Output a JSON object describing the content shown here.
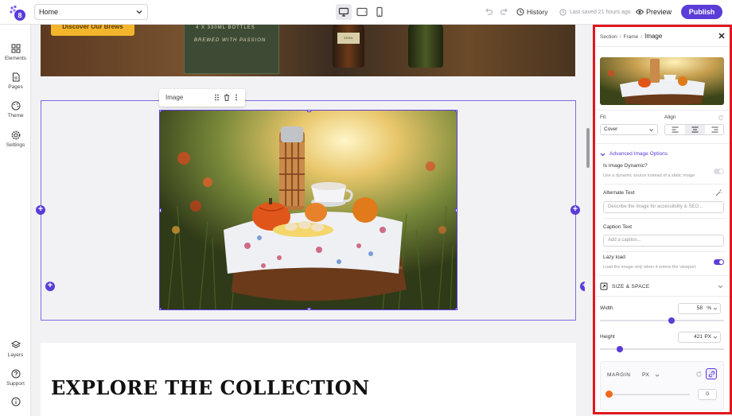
{
  "topbar": {
    "page_name": "Home",
    "history_label": "History",
    "last_saved": "Last saved 21 hours ago",
    "preview_label": "Preview",
    "publish_label": "Publish",
    "device_icons": [
      "desktop-icon",
      "tablet-icon",
      "mobile-icon"
    ],
    "active_device": "desktop"
  },
  "sidebar": {
    "items": [
      {
        "label": "Elements",
        "icon": "grid-icon"
      },
      {
        "label": "Pages",
        "icon": "page-icon"
      },
      {
        "label": "Theme",
        "icon": "palette-icon"
      },
      {
        "label": "Settings",
        "icon": "gear-icon"
      }
    ],
    "bottom_items": [
      {
        "label": "Layers",
        "icon": "layers-icon"
      },
      {
        "label": "Support",
        "icon": "help-icon"
      },
      {
        "label": "",
        "icon": "info-icon"
      }
    ]
  },
  "canvas": {
    "hero_button": "Discover Our Brews",
    "hero_box_line1": "4 X 330ML BOTTLES",
    "hero_box_line2": "BREWED WITH PASSION",
    "bottle_label": "330ML",
    "image_toolbar_label": "Image",
    "explore_heading": "EXPLORE THE COLLECTION"
  },
  "panel": {
    "breadcrumb": [
      "Section",
      "Frame",
      "Image"
    ],
    "fit_label": "Fit",
    "fit_value": "Cover",
    "align_label": "Align",
    "align_active": "center",
    "advanced_label": "Advanced Image Options",
    "dynamic_title": "Is Image Dynamic?",
    "dynamic_sub": "Use a dynamic source instead of a static image",
    "dynamic_on": false,
    "alt_title": "Alternate Text",
    "alt_placeholder": "Describe the image for accessibility & SEO...",
    "caption_title": "Caption Text",
    "caption_placeholder": "Add a caption...",
    "lazy_title": "Lazy load",
    "lazy_sub": "Load the image only when it enters the viewport",
    "lazy_on": true,
    "size_section": "SIZE & SPACE",
    "width_label": "Width",
    "width_value": "58",
    "width_unit": "%",
    "width_fraction": 0.58,
    "height_label": "Height",
    "height_value": "421",
    "height_unit": "PX",
    "margin_label": "MARGIN",
    "margin_unit": "PX",
    "margin_value": "0"
  },
  "colors": {
    "accent": "#5b3cd8",
    "highlight_border": "#e0181e",
    "hero_button": "#f3b52b",
    "margin_knob": "#f06a1c"
  }
}
